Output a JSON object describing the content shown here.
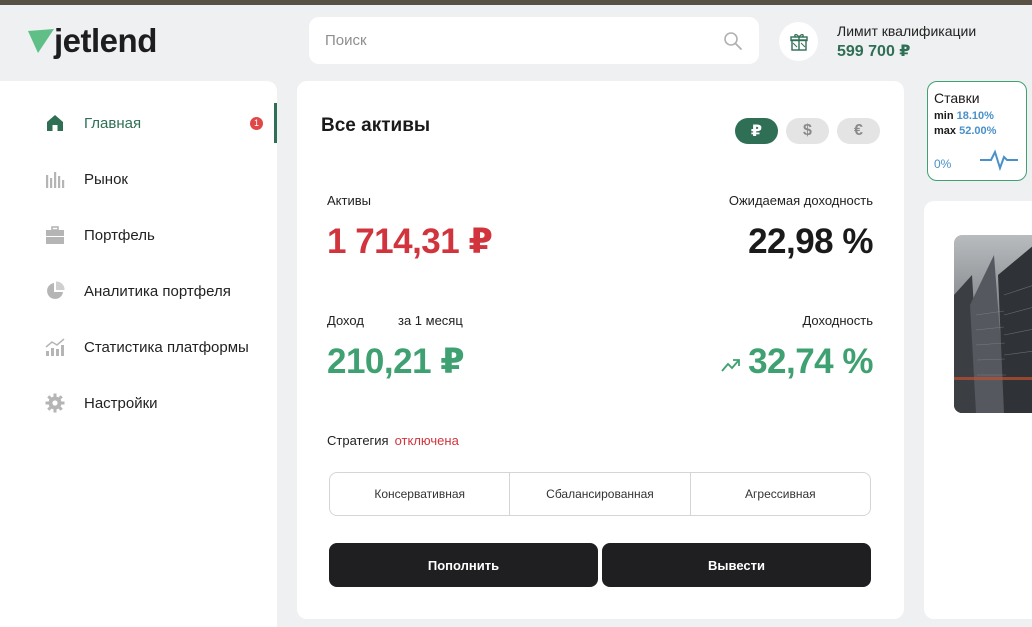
{
  "brand": {
    "name": "jetlend",
    "accent": "#2f6f55",
    "logo_color": "#5fbf86"
  },
  "search": {
    "placeholder": "Поиск"
  },
  "qualification": {
    "label": "Лимит квалификации",
    "value": "599 700 ₽"
  },
  "sidebar": {
    "items": [
      {
        "label": "Главная",
        "icon": "home-icon",
        "active": true,
        "badge": "1"
      },
      {
        "label": "Рынок",
        "icon": "bar-chart-icon"
      },
      {
        "label": "Портфель",
        "icon": "briefcase-icon"
      },
      {
        "label": "Аналитика портфеля",
        "icon": "pie-chart-icon"
      },
      {
        "label": "Статистика платформы",
        "icon": "growth-chart-icon"
      },
      {
        "label": "Настройки",
        "icon": "gear-icon"
      }
    ]
  },
  "assets": {
    "title": "Все активы",
    "currencies": [
      {
        "symbol": "₽",
        "selected": true
      },
      {
        "symbol": "$",
        "selected": false
      },
      {
        "symbol": "€",
        "selected": false
      }
    ],
    "assets_label": "Активы",
    "assets_value": "1 714,31 ₽",
    "expected_yield_label": "Ожидаемая доходность",
    "expected_yield_value": "22,98 %",
    "income_label": "Доход",
    "income_period": "за 1 месяц",
    "income_value": "210,21 ₽",
    "yield_label": "Доходность",
    "yield_value": "32,74 %",
    "strategy_label": "Стратегия",
    "strategy_status": "отключена",
    "strategy_options": [
      "Консервативная",
      "Сбалансированная",
      "Агрессивная"
    ],
    "deposit_button": "Пополнить",
    "withdraw_button": "Вывести",
    "colors": {
      "negative": "#d1343d",
      "positive": "#3fa172"
    }
  },
  "rates": {
    "title": "Ставки",
    "min_label": "min",
    "min_value": "18.10%",
    "max_label": "max",
    "max_value": "52.00%",
    "change": "0%"
  }
}
